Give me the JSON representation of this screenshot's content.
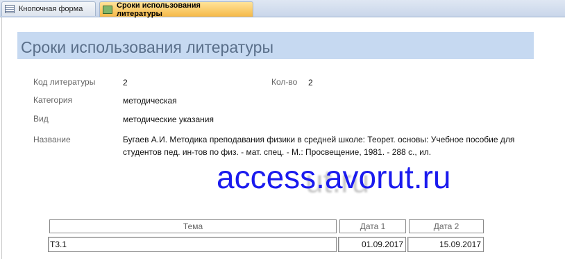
{
  "tabs": [
    {
      "label": "Кнопочная форма",
      "icon": "switchboard-form-icon",
      "active": false
    },
    {
      "label": "Сроки использования литературы",
      "icon": "form-icon",
      "active": true
    }
  ],
  "form": {
    "title": "Сроки использования литературы",
    "fields": {
      "code_label": "Код литературы",
      "code_value": "2",
      "qty_label": "Кол-во",
      "qty_value": "2",
      "category_label": "Категория",
      "category_value": "методическая",
      "kind_label": "Вид",
      "kind_value": "методические указания",
      "name_label": "Название",
      "name_value": "Бугаев А.И. Методика преподавания физики в средней школе: Теорет. основы: Учебное пособие для студентов пед. ин-тов по физ. - мат. спец. - М.: Просвещение, 1981. - 288 с., ил."
    }
  },
  "watermark": {
    "text": "access.avorut.ru",
    "shadow_text": "ut.ru"
  },
  "subtable": {
    "columns": [
      "Тема",
      "Дата 1",
      "Дата 2"
    ],
    "rows": [
      [
        "Т3.1",
        "01.09.2017",
        "15.09.2017"
      ]
    ]
  },
  "colors": {
    "title_band": "#c6d9f1",
    "active_tab": "#f5b948",
    "watermark": "#1a1aee"
  }
}
